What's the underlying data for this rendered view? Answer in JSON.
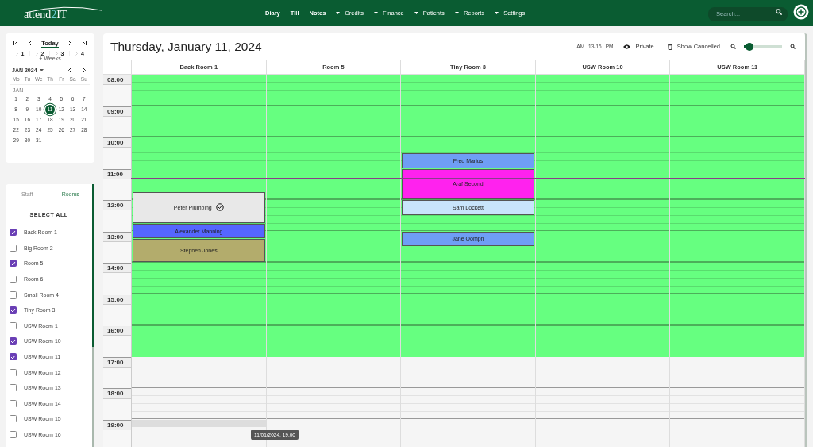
{
  "topbar": {
    "logo": {
      "before": "attend",
      "accent": "2",
      "after": "IT"
    },
    "nav": [
      {
        "label": "Diary",
        "kind": "link"
      },
      {
        "label": "Till",
        "kind": "link"
      },
      {
        "label": "Notes",
        "kind": "link"
      },
      {
        "label": "Credits",
        "kind": "menu"
      },
      {
        "label": "Finance",
        "kind": "menu"
      },
      {
        "label": "Patients",
        "kind": "menu"
      },
      {
        "label": "Reports",
        "kind": "menu"
      },
      {
        "label": "Settings",
        "kind": "menu"
      }
    ],
    "search": {
      "placeholder": "Search..."
    }
  },
  "calendar": {
    "today": "Today",
    "weeks": [
      "1",
      "2",
      "3",
      "4"
    ],
    "weeks_more": "+ Weeks",
    "month": "JAN 2024",
    "weekdays": [
      "Mo",
      "Tu",
      "We",
      "Th",
      "Fr",
      "Sa",
      "Su"
    ],
    "month_label": "JAN",
    "days": [
      {
        "label": "1",
        "selected": false
      },
      {
        "label": "2",
        "selected": false
      },
      {
        "label": "3",
        "selected": false
      },
      {
        "label": "4",
        "selected": false
      },
      {
        "label": "5",
        "selected": false
      },
      {
        "label": "6",
        "selected": false
      },
      {
        "label": "7",
        "selected": false
      },
      {
        "label": "8",
        "selected": false
      },
      {
        "label": "9",
        "selected": false
      },
      {
        "label": "10",
        "selected": false
      },
      {
        "label": "11",
        "selected": true
      },
      {
        "label": "12",
        "selected": false
      },
      {
        "label": "13",
        "selected": false
      },
      {
        "label": "14",
        "selected": false
      },
      {
        "label": "15",
        "selected": false
      },
      {
        "label": "16",
        "selected": false
      },
      {
        "label": "17",
        "selected": false
      },
      {
        "label": "18",
        "selected": false
      },
      {
        "label": "19",
        "selected": false
      },
      {
        "label": "20",
        "selected": false
      },
      {
        "label": "21",
        "selected": false
      },
      {
        "label": "22",
        "selected": false
      },
      {
        "label": "23",
        "selected": false
      },
      {
        "label": "24",
        "selected": false
      },
      {
        "label": "25",
        "selected": false
      },
      {
        "label": "26",
        "selected": false
      },
      {
        "label": "27",
        "selected": false
      },
      {
        "label": "28",
        "selected": false
      },
      {
        "label": "29",
        "selected": false
      },
      {
        "label": "30",
        "selected": false
      },
      {
        "label": "31",
        "selected": false
      }
    ]
  },
  "filter": {
    "tabs": [
      {
        "label": "Staff",
        "selected": false
      },
      {
        "label": "Rooms",
        "selected": true
      }
    ],
    "select_all": "SELECT ALL",
    "items": [
      {
        "label": "Back Room 1",
        "checked": true
      },
      {
        "label": "Big Room 2",
        "checked": false
      },
      {
        "label": "Room 5",
        "checked": true
      },
      {
        "label": "Room 6",
        "checked": false
      },
      {
        "label": "Small Room 4",
        "checked": false
      },
      {
        "label": "Tiny Room 3",
        "checked": true
      },
      {
        "label": "USW Room 1",
        "checked": false
      },
      {
        "label": "USW Room 10",
        "checked": true
      },
      {
        "label": "USW Room 11",
        "checked": true
      },
      {
        "label": "USW Room 12",
        "checked": false
      },
      {
        "label": "USW Room 13",
        "checked": false
      },
      {
        "label": "USW Room 14",
        "checked": false
      },
      {
        "label": "USW Room 15",
        "checked": false
      },
      {
        "label": "USW Room 16",
        "checked": false
      }
    ]
  },
  "diary": {
    "title": "Thursday, January 11, 2024",
    "toolbar": {
      "am": "AM",
      "mid": "13-16",
      "pm": "PM",
      "private": "Private",
      "show_cancelled": "Show Cancelled",
      "zoom": {
        "level": 0.15
      }
    },
    "hours": [
      "08:00",
      "09:00",
      "10:00",
      "11:00",
      "12:00",
      "13:00",
      "14:00",
      "15:00",
      "16:00",
      "17:00",
      "18:00",
      "19:00"
    ],
    "rooms": [
      {
        "name": "Back Room 1",
        "appointments": [
          {
            "name": "Peter Plumbing",
            "color": "#e8e8e8",
            "confirmed": true
          },
          {
            "name": "Alexander Manning",
            "color": "#5566ff",
            "confirmed": false
          },
          {
            "name": "Stephen Jones",
            "color": "#b3ac6c",
            "confirmed": false
          }
        ]
      },
      {
        "name": "Room 5"
      },
      {
        "name": "Tiny Room 3",
        "appointments": [
          {
            "name": "Fred Marius",
            "color": "#6f9ef5",
            "confirmed": false
          },
          {
            "name": "Araf Second",
            "color": "#ff22ee",
            "confirmed": false
          },
          {
            "name": "Sam Lockett",
            "color": "#c8e4fb",
            "confirmed": false
          },
          {
            "name": "Jane Oomph",
            "color": "#6f9ef5",
            "confirmed": false
          }
        ]
      },
      {
        "name": "USW Room 10"
      },
      {
        "name": "USW Room 11"
      }
    ],
    "tooltip": "11/01/2024, 19:00"
  }
}
